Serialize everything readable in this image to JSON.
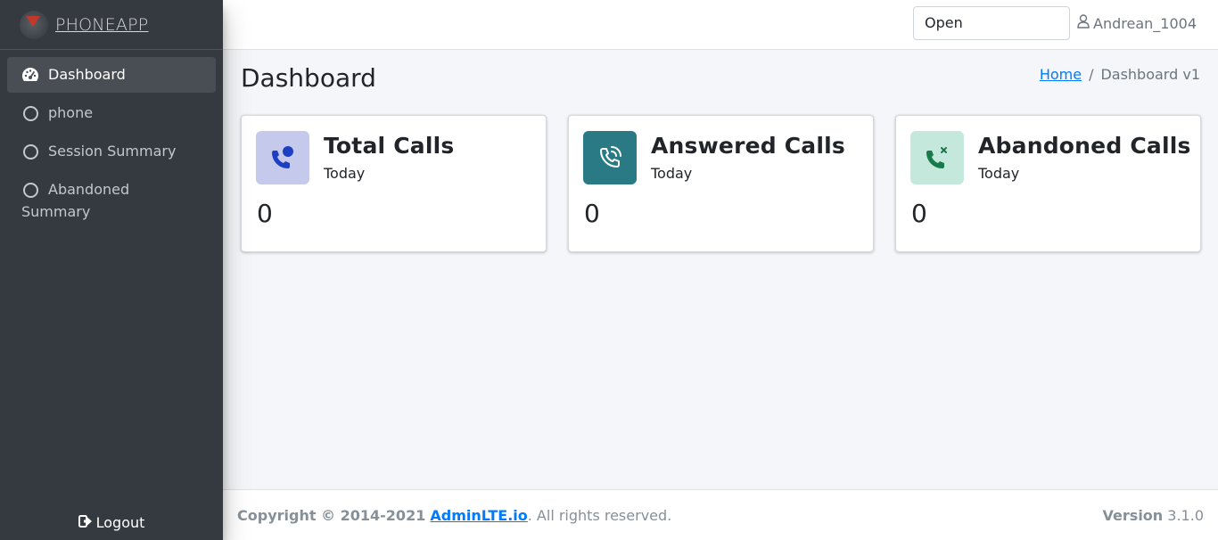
{
  "brand": {
    "name": "PHONEAPP"
  },
  "sidebar": {
    "items": [
      {
        "label": "Dashboard",
        "icon": "tachometer-icon",
        "active": true
      },
      {
        "label": "phone",
        "icon": "circle-icon"
      },
      {
        "label": "Session Summary",
        "icon": "circle-icon"
      },
      {
        "label": "Abandoned Summary",
        "icon": "circle-icon"
      }
    ],
    "logout_label": "Logout"
  },
  "topbar": {
    "status_value": "Open",
    "username": "Andrean_1004"
  },
  "page": {
    "title": "Dashboard",
    "breadcrumb": {
      "home": "Home",
      "current": "Dashboard v1"
    }
  },
  "cards": [
    {
      "title": "Total Calls",
      "subtitle": "Today",
      "value": "0",
      "icon": "user-phone-icon",
      "icon_bg": "#c5c9ec",
      "icon_color": "#1d3fc1"
    },
    {
      "title": "Answered Calls",
      "subtitle": "Today",
      "value": "0",
      "icon": "phone-volume-icon",
      "icon_bg": "#2a7a86",
      "icon_color": "#ffffff"
    },
    {
      "title": "Abandoned Calls",
      "subtitle": "Today",
      "value": "0",
      "icon": "phone-slash-icon",
      "icon_bg": "#c5e8dc",
      "icon_color": "#177a4a"
    }
  ],
  "footer": {
    "copyright_prefix": "Copyright © 2014-2021",
    "link": "AdminLTE.io",
    "suffix": ". All rights reserved.",
    "version_label": "Version",
    "version": "3.1.0"
  }
}
